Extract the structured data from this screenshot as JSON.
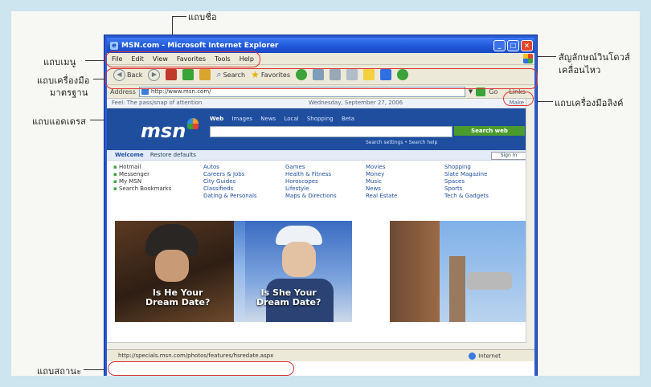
{
  "callouts": {
    "title_bar": "แถบชื่อ",
    "menu_bar": "แถบเมนู",
    "standard_toolbar_line1": "แถบเครื่องมือ",
    "standard_toolbar_line2": "มาตรฐาน",
    "address_bar": "แถบแอดเดรส",
    "windows_logo_line1": "สัญลักษณ์วินโดวส์",
    "windows_logo_line2": "เคลื่อนไหว",
    "links_toolbar": "แถบเครื่องมือลิงค์",
    "status_bar": "แถบสถานะ"
  },
  "window": {
    "title": "MSN.com - Microsoft Internet Explorer",
    "menus": [
      "File",
      "Edit",
      "View",
      "Favorites",
      "Tools",
      "Help"
    ],
    "toolbar": {
      "back": "Back",
      "search": "Search",
      "favorites": "Favorites"
    },
    "address_label": "Address",
    "address_value": "http://www.msn.com/",
    "go_label": "Go",
    "links_label": "Links"
  },
  "page": {
    "infobar_left": "Feel: The pass/snap of attention",
    "infobar_date": "Wednesday, September 27, 2006",
    "infobar_right": "Make it",
    "msn_logo": "msn",
    "search_tabs": [
      "Web",
      "Images",
      "News",
      "Local",
      "Shopping",
      "Beta"
    ],
    "search_button": "Search web",
    "under_search": "Search settings • Search help",
    "welcome": "Welcome",
    "welcome_sub": "Restore defaults",
    "signin": "Sign In",
    "left_links": [
      "Hotmail",
      "Messenger",
      "My MSN",
      "Search Bookmarks"
    ],
    "col1": [
      "Autos",
      "Careers & Jobs",
      "City Guides",
      "Classifieds",
      "Dating & Personals"
    ],
    "col2": [
      "Games",
      "Health & Fitness",
      "Horoscopes",
      "Lifestyle",
      "Maps & Directions"
    ],
    "col3": [
      "Movies",
      "Money",
      "Music",
      "News",
      "Real Estate"
    ],
    "col4": [
      "Shopping",
      "Slate Magazine",
      "Spaces",
      "Sports",
      "Tech & Gadgets"
    ],
    "banner_text_1_line1": "Is He Your",
    "banner_text_1_line2": "Dream Date?",
    "banner_text_2_line1": "Is She Your",
    "banner_text_2_line2": "Dream Date?"
  },
  "status": {
    "url": "http://specials.msn.com/photos/features/hsredate.aspx",
    "zone": "Internet"
  }
}
